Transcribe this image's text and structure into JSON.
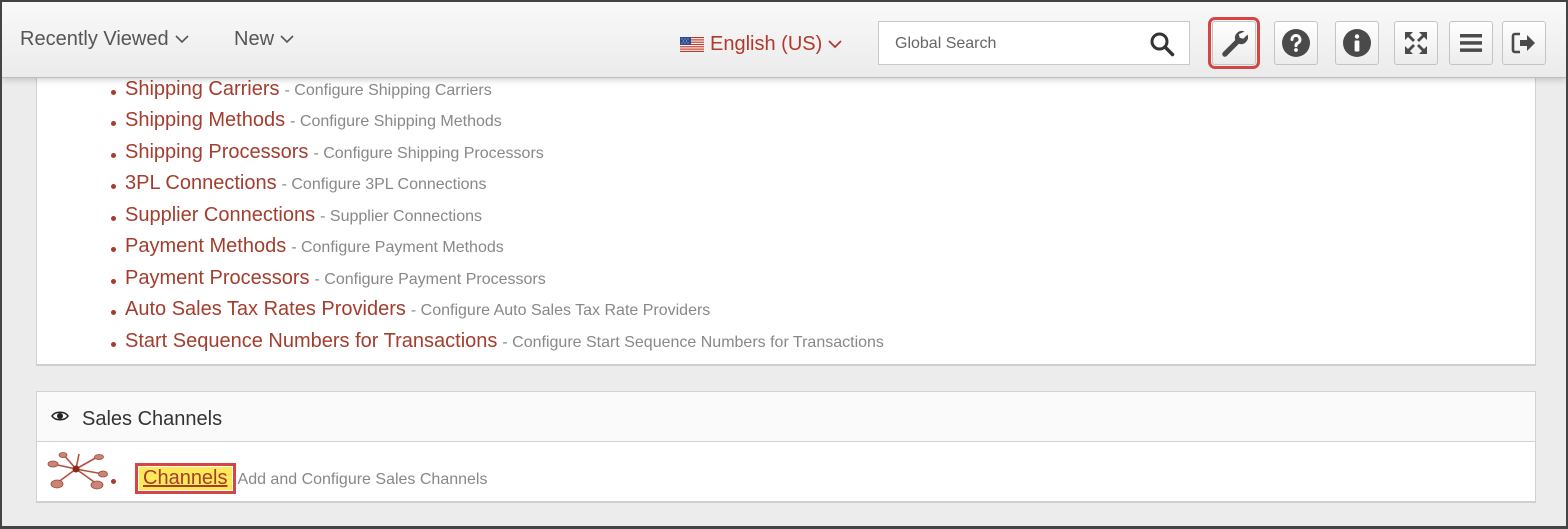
{
  "topbar": {
    "recently_viewed_label": "Recently Viewed",
    "new_label": "New",
    "language_label": "English (US)",
    "search_placeholder": "Global Search",
    "buttons": [
      "wrench-icon",
      "help-icon",
      "info-icon",
      "fullscreen-icon",
      "menu-icon",
      "logout-icon"
    ],
    "highlight_color": "#d64545"
  },
  "settings_list": [
    {
      "label": "Shipping Carriers",
      "desc": "- Configure Shipping Carriers"
    },
    {
      "label": "Shipping Methods",
      "desc": "- Configure Shipping Methods"
    },
    {
      "label": "Shipping Processors",
      "desc": "- Configure Shipping Processors"
    },
    {
      "label": "3PL Connections",
      "desc": "- Configure 3PL Connections"
    },
    {
      "label": "Supplier Connections",
      "desc": "- Supplier Connections"
    },
    {
      "label": "Payment Methods",
      "desc": "- Configure Payment Methods"
    },
    {
      "label": "Payment Processors",
      "desc": "- Configure Payment Processors"
    },
    {
      "label": "Auto Sales Tax Rates Providers",
      "desc": "- Configure Auto Sales Tax Rate Providers"
    },
    {
      "label": "Start Sequence Numbers for Transactions",
      "desc": "- Configure Start Sequence Numbers for Transactions"
    }
  ],
  "sales_channels": {
    "title": "Sales Channels",
    "channels_label": "Channels",
    "channels_desc": "Add and Configure Sales Channels"
  },
  "colors": {
    "link": "#a33d2e",
    "desc": "#888888",
    "highlight_bg": "#ffe959"
  }
}
